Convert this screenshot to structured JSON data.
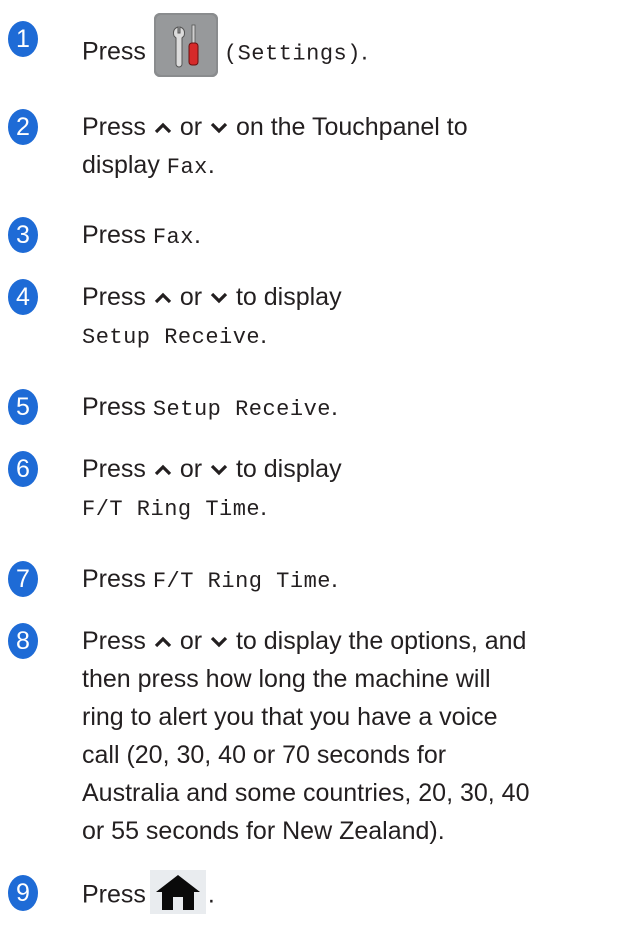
{
  "accent_color": "#1e6bd6",
  "steps": [
    {
      "num": "1",
      "press": "Press",
      "code": "(Settings)",
      "end": "."
    },
    {
      "num": "2",
      "press": "Press",
      "or": "or",
      "line1_rest": "on the Touchpanel to",
      "line2_a": "display",
      "code": "Fax",
      "end": "."
    },
    {
      "num": "3",
      "press": "Press",
      "code": "Fax",
      "end": "."
    },
    {
      "num": "4",
      "press": "Press",
      "or": "or",
      "rest": "to display",
      "code": "Setup Receive",
      "end": "."
    },
    {
      "num": "5",
      "press": "Press",
      "code": "Setup Receive",
      "end": "."
    },
    {
      "num": "6",
      "press": "Press",
      "or": "or",
      "rest": "to display",
      "code": "F/T Ring Time",
      "end": "."
    },
    {
      "num": "7",
      "press": "Press",
      "code": "F/T Ring Time",
      "end": "."
    },
    {
      "num": "8",
      "press": "Press",
      "or": "or",
      "line1_rest": "to display the options, and",
      "lines": [
        "then press how long the machine will",
        "ring to alert you that you have a voice",
        "call (20, 30, 40 or 70 seconds for",
        "Australia and some countries, 20, 30, 40",
        "or 55 seconds for New Zealand)."
      ]
    },
    {
      "num": "9",
      "press": "Press",
      "end": "."
    }
  ],
  "icons": {
    "settings": "settings-icon",
    "home": "home-icon",
    "up": "up-arrow-icon",
    "down": "down-arrow-icon"
  }
}
